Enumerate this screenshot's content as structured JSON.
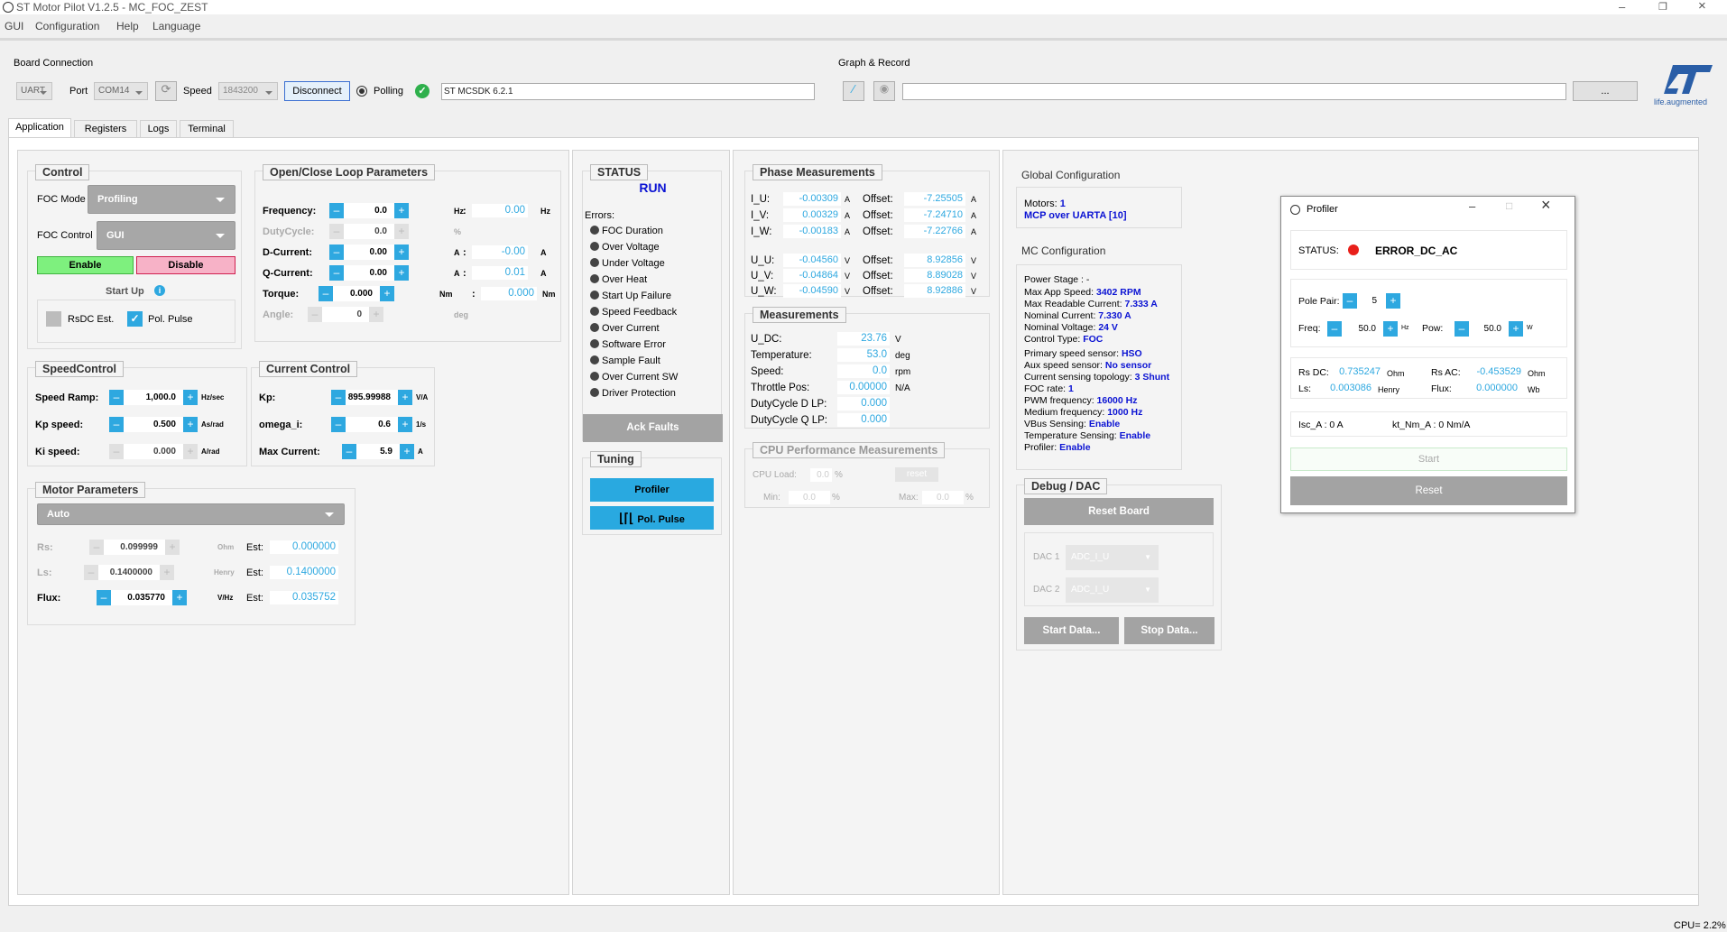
{
  "window": {
    "title": "ST Motor Pilot V1.2.5 - MC_FOC_ZEST"
  },
  "menu": [
    "GUI",
    "Configuration",
    "Help",
    "Language"
  ],
  "board": {
    "title": "Board Connection",
    "protocol": "UART",
    "port_label": "Port",
    "port": "COM14",
    "speed_label": "Speed",
    "speed": "1843200",
    "disconnect": "Disconnect",
    "polling": "Polling",
    "sdk": "ST MCSDK 6.2.1"
  },
  "graph": {
    "title": "Graph & Record",
    "browse": "..."
  },
  "logo": {
    "tagline": "life.augmented"
  },
  "tabs": [
    "Application",
    "Registers",
    "Logs",
    "Terminal"
  ],
  "control": {
    "title": "Control",
    "foc_mode_label": "FOC Mode",
    "foc_mode": "Profiling",
    "foc_control_label": "FOC Control",
    "foc_control": "GUI",
    "enable": "Enable",
    "disable": "Disable",
    "startup": "Start Up",
    "rsdc": "RsDC Est.",
    "polpulse": "Pol. Pulse"
  },
  "ocl": {
    "title": "Open/Close Loop Parameters",
    "rows": [
      {
        "label": "Frequency:",
        "value": "0.0",
        "unit": "Hz",
        "colon": ":",
        "readout": "0.00",
        "runit": "Hz",
        "enabled": true
      },
      {
        "label": "DutyCycle:",
        "value": "0.0",
        "unit": "%",
        "colon": "",
        "readout": "",
        "runit": "",
        "enabled": false
      },
      {
        "label": "D-Current:",
        "value": "0.00",
        "unit": "A",
        "colon": ":",
        "readout": "-0.00",
        "runit": "A",
        "enabled": true
      },
      {
        "label": "Q-Current:",
        "value": "0.00",
        "unit": "A",
        "colon": ":",
        "readout": "0.01",
        "runit": "A",
        "enabled": true
      },
      {
        "label": "Torque:",
        "value": "0.000",
        "unit": "Nm",
        "colon": ":",
        "readout": "0.000",
        "runit": "Nm",
        "enabled": true
      },
      {
        "label": "Angle:",
        "value": "0",
        "unit": "deg",
        "colon": "",
        "readout": "",
        "runit": "",
        "enabled": false
      }
    ]
  },
  "speed": {
    "title": "SpeedControl",
    "rows": [
      {
        "label": "Speed Ramp:",
        "value": "1,000.0",
        "unit": "Hz/sec"
      },
      {
        "label": "Kp speed:",
        "value": "0.500",
        "unit": "As/rad"
      },
      {
        "label": "Ki speed:",
        "value": "0.000",
        "unit": "A/rad"
      }
    ]
  },
  "current": {
    "title": "Current Control",
    "rows": [
      {
        "label": "Kp:",
        "value": "895.99988",
        "unit": "V/A"
      },
      {
        "label": "omega_i:",
        "value": "0.6",
        "unit": "1/s"
      },
      {
        "label": "Max Current:",
        "value": "5.9",
        "unit": "A"
      }
    ]
  },
  "motor": {
    "title": "Motor Parameters",
    "mode": "Auto",
    "rows": [
      {
        "label": "Rs:",
        "value": "0.099999",
        "unit": "Ohm",
        "est_label": "Est:",
        "est": "0.000000",
        "enabled": false
      },
      {
        "label": "Ls:",
        "value": "0.1400000",
        "unit": "Henry",
        "est_label": "Est:",
        "est": "0.1400000",
        "enabled": false
      },
      {
        "label": "Flux:",
        "value": "0.035770",
        "unit": "V/Hz",
        "est_label": "Est:",
        "est": "0.035752",
        "enabled": true
      }
    ]
  },
  "status": {
    "title": "STATUS",
    "state": "RUN",
    "errors_label": "Errors:",
    "errors": [
      "FOC Duration",
      "Over Voltage",
      "Under Voltage",
      "Over Heat",
      "Start Up Failure",
      "Speed Feedback",
      "Over Current",
      "Software Error",
      "Sample Fault",
      "Over Current SW",
      "Driver Protection"
    ],
    "ack": "Ack Faults"
  },
  "tuning": {
    "title": "Tuning",
    "profiler": "Profiler",
    "polpulse": "Pol. Pulse"
  },
  "phase": {
    "title": "Phase Measurements",
    "rows": [
      {
        "label": "I_U:",
        "value": "-0.00309",
        "unit": "A",
        "off_label": "Offset:",
        "offset": "-7.25505",
        "ounit": "A"
      },
      {
        "label": "I_V:",
        "value": "0.00329",
        "unit": "A",
        "off_label": "Offset:",
        "offset": "-7.24710",
        "ounit": "A"
      },
      {
        "label": "I_W:",
        "value": "-0.00183",
        "unit": "A",
        "off_label": "Offset:",
        "offset": "-7.22766",
        "ounit": "A"
      },
      {
        "label": "U_U:",
        "value": "-0.04560",
        "unit": "V",
        "off_label": "Offset:",
        "offset": "8.92856",
        "ounit": "V"
      },
      {
        "label": "U_V:",
        "value": "-0.04864",
        "unit": "V",
        "off_label": "Offset:",
        "offset": "8.89028",
        "ounit": "V"
      },
      {
        "label": "U_W:",
        "value": "-0.04590",
        "unit": "V",
        "off_label": "Offset:",
        "offset": "8.92886",
        "ounit": "V"
      }
    ]
  },
  "meas": {
    "title": "Measurements",
    "rows": [
      {
        "label": "U_DC:",
        "value": "23.76",
        "unit": "V"
      },
      {
        "label": "Temperature:",
        "value": "53.0",
        "unit": "deg"
      },
      {
        "label": "Speed:",
        "value": "0.0",
        "unit": "rpm"
      },
      {
        "label": "Throttle Pos:",
        "value": "0.00000",
        "unit": "N/A"
      },
      {
        "label": "DutyCycle D LP:",
        "value": "0.000",
        "unit": ""
      },
      {
        "label": "DutyCycle Q LP:",
        "value": "0.000",
        "unit": ""
      }
    ]
  },
  "cpu": {
    "title": "CPU Performance Measurements",
    "load_label": "CPU Load:",
    "load": "0.0",
    "load_unit": "%",
    "reset": "reset",
    "min_label": "Min:",
    "min": "0.0",
    "min_unit": "%",
    "max_label": "Max:",
    "max": "0.0",
    "max_unit": "%"
  },
  "global": {
    "title": "Global Configuration",
    "motors_label": "Motors:",
    "motors": "1",
    "mcp": "MCP over UARTA [10]"
  },
  "mcconf": {
    "title": "MC Configuration",
    "lines": [
      {
        "k": "Power Stage :",
        "v": " -",
        "plain": true
      },
      {
        "k": "Max App Speed:",
        "v": "3402 RPM"
      },
      {
        "k": "Max Readable Current:",
        "v": "7.333 A"
      },
      {
        "k": "Nominal Current:",
        "v": "7.330 A"
      },
      {
        "k": "Nominal Voltage:",
        "v": "24 V"
      },
      {
        "k": "Control Type:",
        "v": "FOC"
      },
      {
        "k": "Primary speed sensor:",
        "v": "HSO"
      },
      {
        "k": "Aux speed sensor:",
        "v": "No sensor"
      },
      {
        "k": "Current sensing topology:",
        "v": "3 Shunt"
      },
      {
        "k": "FOC rate:",
        "v": "1"
      },
      {
        "k": "PWM frequency:",
        "v": "16000 Hz"
      },
      {
        "k": "Medium frequency:",
        "v": "1000 Hz"
      },
      {
        "k": "VBus Sensing:",
        "v": "Enable"
      },
      {
        "k": "Temperature Sensing:",
        "v": "Enable"
      },
      {
        "k": "Profiler:",
        "v": "Enable"
      }
    ]
  },
  "debug": {
    "title": "Debug / DAC",
    "reset": "Reset Board",
    "dac1_label": "DAC 1",
    "dac1": "ADC_I_U",
    "dac2_label": "DAC 2",
    "dac2": "ADC_I_U",
    "start": "Start Data...",
    "stop": "Stop Data..."
  },
  "profiler": {
    "title": "Profiler",
    "status_label": "STATUS:",
    "status": "ERROR_DC_AC",
    "status_color": "#e8201a",
    "pole_label": "Pole Pair:",
    "pole": "5",
    "freq_label": "Freq:",
    "freq": "50.0",
    "freq_unit": "Hz",
    "pow_label": "Pow:",
    "pow": "50.0",
    "pow_unit": "W",
    "rsdc_label": "Rs DC:",
    "rsdc": "0.735247",
    "rsdc_unit": "Ohm",
    "rsac_label": "Rs AC:",
    "rsac": "-0.453529",
    "rsac_unit": "Ohm",
    "ls_label": "Ls:",
    "ls": "0.003086",
    "ls_unit": "Henry",
    "flux_label": "Flux:",
    "flux": "0.000000",
    "flux_unit": "Wb",
    "isc": "Isc_A : 0 A",
    "kt": "kt_Nm_A : 0 Nm/A",
    "start": "Start",
    "reset": "Reset"
  },
  "statusbar": {
    "cpu": "CPU= 2.2%"
  },
  "colors": {
    "accent": "#2ea8e0",
    "enable": "#7ef07e",
    "disable": "#f7b2c7",
    "status_blue": "#0b13d3"
  }
}
